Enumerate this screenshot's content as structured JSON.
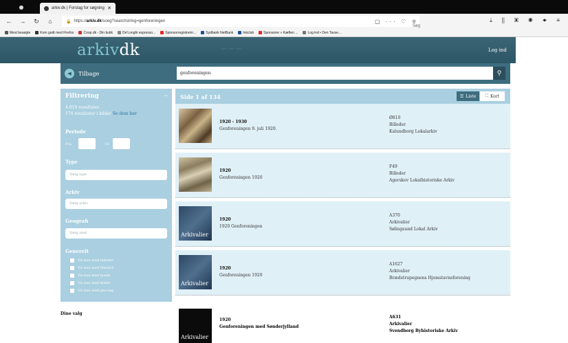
{
  "browser": {
    "tab_title": "arkiv.dk | Forslag for søgning",
    "url_prefix": "https://",
    "url_domain": "arkiv.dk",
    "url_path": "/soeg?searchstring=genforeningen",
    "search_placeholder": "Søg",
    "bookmarks": [
      {
        "label": "Mest besøgte",
        "color": "#555"
      },
      {
        "label": "Kom godt med Firefox",
        "color": "#333"
      },
      {
        "label": "Coop.dk - Din butik",
        "color": "#c33"
      },
      {
        "label": "De'Longhi espresso...",
        "color": "#888"
      },
      {
        "label": "Sponsorregistrerin...",
        "color": "#e22"
      },
      {
        "label": "Sydbank NetBank",
        "color": "#1f4e9a"
      },
      {
        "label": "Inkclub",
        "color": "#1f4e9a"
      },
      {
        "label": "Sponsorer » Kæften ...",
        "color": "#e22"
      },
      {
        "label": "Log ind • Den Tavse...",
        "color": "#777"
      }
    ]
  },
  "site": {
    "logo_main": "arkiv",
    "logo_suffix": "dk",
    "login_label": "Log ind",
    "back_label": "Tilbage",
    "search_value": "genforeningen"
  },
  "filter": {
    "title": "Filtrering",
    "result_count": "4.019 resultater",
    "sources_count": "174 resultater i kilder",
    "sources_link": "Se dem her",
    "period_label": "Periode",
    "from_label": "Fra",
    "to_label": "Til",
    "type_label": "Type",
    "type_placeholder": "Vælg type",
    "archive_label": "Arkiv",
    "archive_placeholder": "Vælg arkiv",
    "geo_label": "Geografi",
    "geo_placeholder": "Vælg sted",
    "general_label": "Generelt",
    "checkboxes": [
      "Vis kun med billeder",
      "Vis kun med film/lyd",
      "Vis kun med fysisk",
      "Vis kun med kilder",
      "Vis kun med geo-tag"
    ],
    "my_choices_label": "Dine valg"
  },
  "results_header": {
    "page_info": "Side 1 af 134",
    "view_list": "Liste",
    "view_map": "Kort"
  },
  "results": [
    {
      "date": "1920 - 1930",
      "title": "Genforeningen 9. juli 1920.",
      "id": "Ø810",
      "type": "Billeder",
      "archive": "Kalundborg Lokalarkiv",
      "thumb_text": ""
    },
    {
      "date": "1920",
      "title": "Genforeningen 1920",
      "id": "F49",
      "type": "Billeder",
      "archive": "Agerskov Lokalhistoriske Arkiv",
      "thumb_text": ""
    },
    {
      "date": "1920",
      "title": "1920 Genforeningen",
      "id": "A370",
      "type": "Arkivalier",
      "archive": "Sølingsund Lokal Arkiv",
      "thumb_text": "Arkivalier"
    },
    {
      "date": "1920",
      "title": "Genforeningen 1920",
      "id": "A1627",
      "type": "Arkivalier",
      "archive": "Brædstrupegnens Hjemstavnsforening",
      "thumb_text": "Arkivalier"
    },
    {
      "date": "1920",
      "title": "Genforeningen med Sønderjylland",
      "id": "A631",
      "type": "Arkivalier",
      "archive": "Svendborg Byhistoriske Arkiv",
      "thumb_text": "Arkivalier"
    }
  ]
}
